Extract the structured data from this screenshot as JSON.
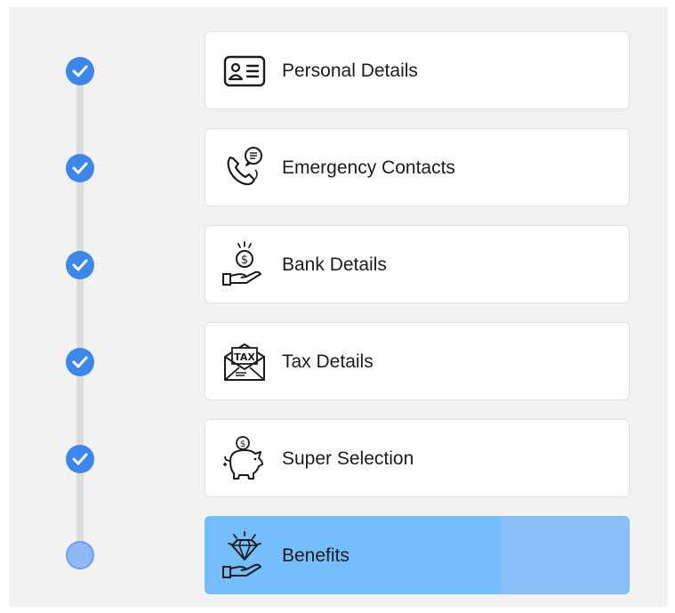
{
  "steps": [
    {
      "label": "Personal Details",
      "status": "complete",
      "icon": "id-card-icon"
    },
    {
      "label": "Emergency Contacts",
      "status": "complete",
      "icon": "phone-chat-icon"
    },
    {
      "label": "Bank Details",
      "status": "complete",
      "icon": "money-hand-icon"
    },
    {
      "label": "Tax Details",
      "status": "complete",
      "icon": "tax-envelope-icon"
    },
    {
      "label": "Super Selection",
      "status": "complete",
      "icon": "piggy-bank-icon"
    },
    {
      "label": "Benefits",
      "status": "current",
      "icon": "diamond-hand-icon"
    }
  ],
  "colors": {
    "complete": "#3d87ea",
    "current": "#8fb8f6",
    "active_card": "#74befe"
  }
}
